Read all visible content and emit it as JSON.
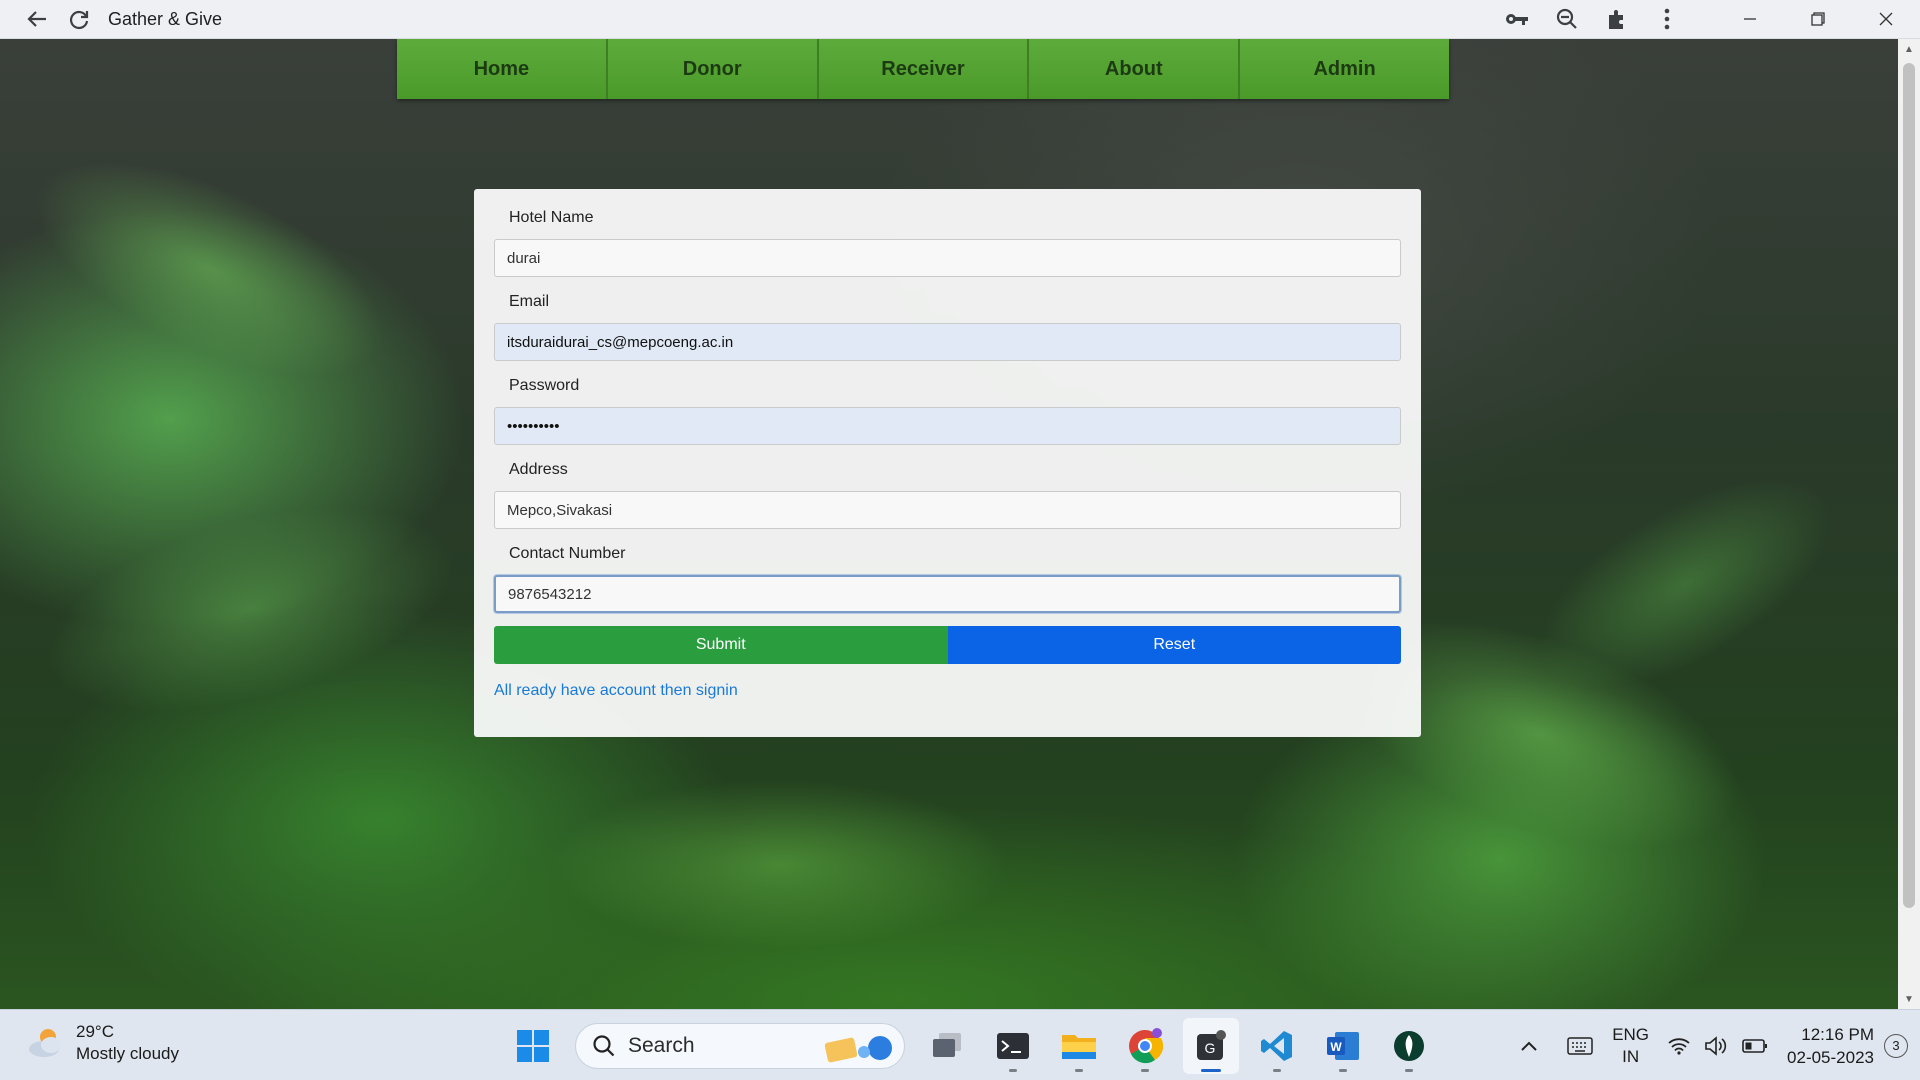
{
  "browser": {
    "title": "Gather & Give",
    "icons": [
      "back-arrow-icon",
      "reload-icon",
      "key-icon",
      "zoom-icon",
      "extensions-puzzle-icon",
      "more-vert-icon"
    ],
    "window_controls": [
      "minimize-icon",
      "restore-icon",
      "close-icon"
    ]
  },
  "nav": {
    "items": [
      "Home",
      "Donor",
      "Receiver",
      "About",
      "Admin"
    ],
    "color": "#4f9e2e"
  },
  "form": {
    "fields": [
      {
        "label": "Hotel Name",
        "value": "durai"
      },
      {
        "label": "Email",
        "value": "itsduraidurai_cs@mepcoeng.ac.in"
      },
      {
        "label": "Password",
        "value": "••••••••••"
      },
      {
        "label": "Address",
        "value": "Mepco,Sivakasi"
      },
      {
        "label": "Contact Number",
        "value": "9876543212"
      }
    ],
    "submit_label": "Submit",
    "reset_label": "Reset",
    "signin_link": "All ready have account then signin",
    "colors": {
      "submit": "#2a9d3f",
      "reset": "#0b63e5",
      "link": "#1a7ad6"
    }
  },
  "taskbar": {
    "weather": {
      "temp": "29°C",
      "desc": "Mostly cloudy"
    },
    "search_label": "Search",
    "apps": [
      "windows-start-icon",
      "search-icon",
      "task-view-icon",
      "terminal-icon",
      "file-explorer-icon",
      "chrome-icon",
      "gather-give-app-icon",
      "vscode-icon",
      "word-icon",
      "mongodb-compass-icon"
    ],
    "tray": {
      "lang_line1": "ENG",
      "lang_line2": "IN",
      "time": "12:16 PM",
      "date": "02-05-2023",
      "notifications": "3"
    }
  }
}
